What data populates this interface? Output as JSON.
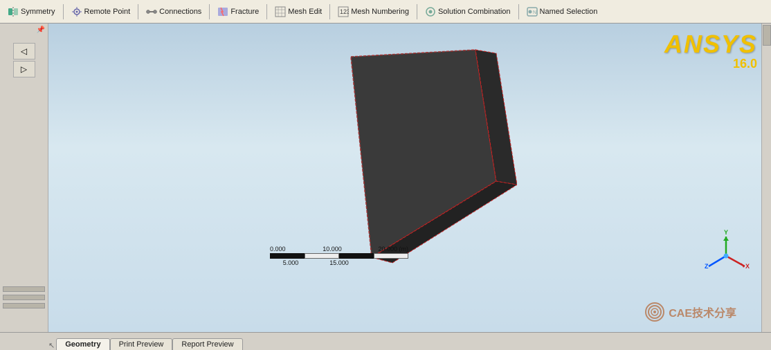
{
  "toolbar": {
    "items": [
      {
        "label": "Symmetry",
        "icon": "⊞",
        "id": "symmetry"
      },
      {
        "label": "Remote Point",
        "icon": "◎",
        "id": "remote-point"
      },
      {
        "label": "Connections",
        "icon": "⊕",
        "id": "connections"
      },
      {
        "label": "Fracture",
        "icon": "◈",
        "id": "fracture"
      },
      {
        "label": "Mesh Edit",
        "icon": "⊟",
        "id": "mesh-edit"
      },
      {
        "label": "Mesh Numbering",
        "icon": "⊞",
        "id": "mesh-numbering"
      },
      {
        "label": "Solution Combination",
        "icon": "◉",
        "id": "solution-combination"
      },
      {
        "label": "Named Selection",
        "icon": "◈",
        "id": "named-selection"
      }
    ]
  },
  "viewport": {
    "ansys_brand": "ANSYS",
    "ansys_version": "16.0"
  },
  "scale": {
    "labels_top": [
      "0.000",
      "10.000",
      "20.000 (m)"
    ],
    "labels_bottom": [
      "5.000",
      "15.000"
    ]
  },
  "axis": {
    "x_label": "X",
    "y_label": "Y",
    "z_label": "Z"
  },
  "tabs": [
    {
      "label": "Geometry",
      "active": true
    },
    {
      "label": "Print Preview",
      "active": false
    },
    {
      "label": "Report Preview",
      "active": false
    }
  ],
  "watermark": {
    "text": "CAE技术分享"
  },
  "sidebar": {
    "pin_icon": "📌",
    "tools": [
      {
        "icon": "←",
        "label": "back"
      },
      {
        "icon": "→",
        "label": "forward"
      }
    ]
  }
}
